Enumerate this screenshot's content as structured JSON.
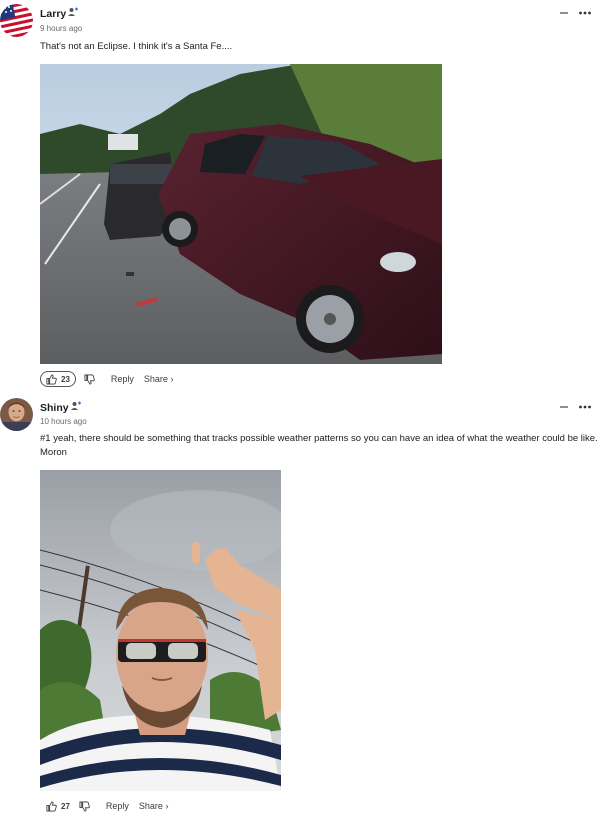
{
  "comments": [
    {
      "username": "Larry",
      "timestamp": "9 hours ago",
      "text": "That's not an Eclipse. I think it's a Santa Fe....",
      "like_count": "23",
      "reply_label": "Reply",
      "share_label": "Share ›"
    },
    {
      "username": "Shiny",
      "timestamp": "10 hours ago",
      "text": "#1 yeah, there should be something that tracks possible weather patterns so you can have an idea of what the weather could be like. Moron",
      "like_count": "27",
      "reply_label": "Reply",
      "share_label": "Share ›"
    }
  ],
  "icons": {
    "follow": "follow-user-icon",
    "minimize": "minimize-icon",
    "more": "more-options-icon",
    "like": "thumbs-up-icon",
    "dislike": "thumbs-down-icon"
  },
  "colors": {
    "text": "#1d1d1f",
    "muted": "#6b6b6b",
    "follow_accent": "#3a6fd8"
  }
}
